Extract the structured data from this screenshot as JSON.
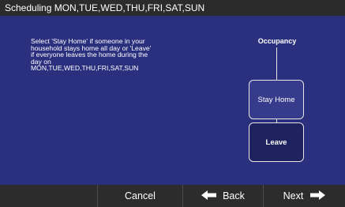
{
  "title": "Scheduling MON,TUE,WED,THU,FRI,SAT,SUN",
  "instructions": [
    "Select 'Stay Home' if someone in your",
    "household stays home all day or 'Leave'",
    "if everyone leaves the home during the",
    "day on",
    "MON,TUE,WED,THU,FRI,SAT,SUN"
  ],
  "occupancy": {
    "title": "Occupancy",
    "options": [
      {
        "label": "Stay Home",
        "selected": false
      },
      {
        "label": "Leave",
        "selected": true
      }
    ]
  },
  "nav": {
    "cancel": "Cancel",
    "back": "Back",
    "next": "Next",
    "back_icon": "arrow-left-icon",
    "next_icon": "arrow-right-icon"
  },
  "colors": {
    "background": "#2a2f7e",
    "titlebar": "#2b2b2b",
    "bottombar": "#2c2c2c",
    "selected_option": "#1e225e",
    "text": "#ffffff"
  }
}
